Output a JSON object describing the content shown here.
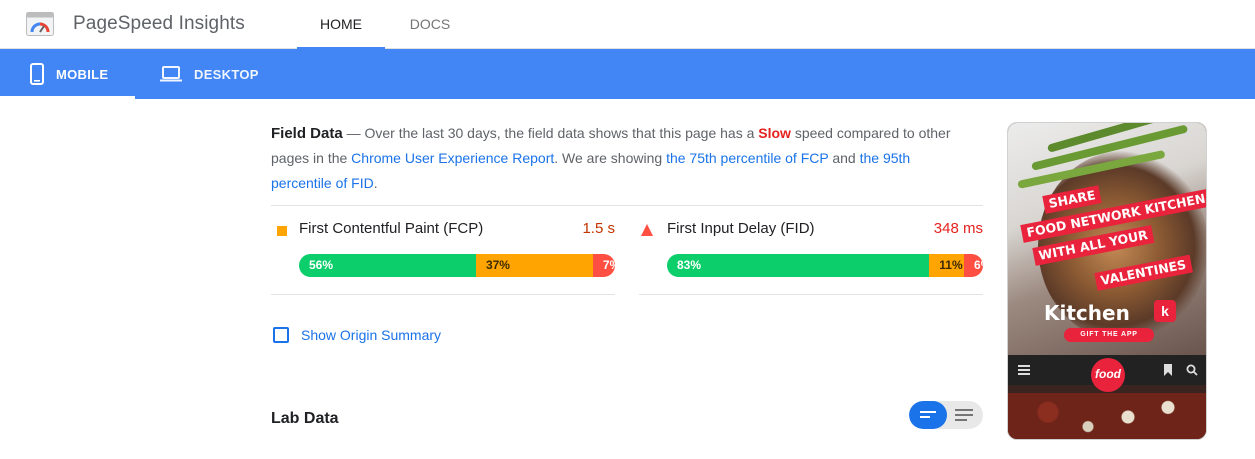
{
  "header": {
    "app_title": "PageSpeed Insights",
    "tabs": [
      {
        "label": "HOME",
        "active": true
      },
      {
        "label": "DOCS",
        "active": false
      }
    ]
  },
  "device_tabs": [
    {
      "label": "MOBILE",
      "icon": "smartphone-icon",
      "active": true
    },
    {
      "label": "DESKTOP",
      "icon": "laptop-icon",
      "active": false
    }
  ],
  "field_data": {
    "heading": "Field Data",
    "desc_prefix": " — Over the last 30 days, the field data shows that this page has a ",
    "speed": "Slow",
    "desc_mid": " speed compared to other pages in the ",
    "report_link": "Chrome User Experience Report",
    "desc_showing": ". We are showing ",
    "fcp_link": "the 75th percentile of FCP",
    "desc_and": " and ",
    "fid_link": "the 95th percentile of FID",
    "desc_end": ".",
    "metrics": [
      {
        "label": "First Contentful Paint (FCP)",
        "value": "1.5 s",
        "indicator": "average-square-icon",
        "distribution": [
          {
            "label": "56%",
            "pct": 56,
            "color": "#0cce6b"
          },
          {
            "label": "37%",
            "pct": 37,
            "color": "#ffa400"
          },
          {
            "label": "7%",
            "pct": 7,
            "color": "#ff4e42"
          }
        ]
      },
      {
        "label": "First Input Delay (FID)",
        "value": "348 ms",
        "indicator": "slow-triangle-icon",
        "distribution": [
          {
            "label": "83%",
            "pct": 83,
            "color": "#0cce6b"
          },
          {
            "label": "11%",
            "pct": 11,
            "color": "#ffa400"
          },
          {
            "label": "6%",
            "pct": 6,
            "color": "#ff4e42"
          }
        ]
      }
    ],
    "origin_summary_label": "Show Origin Summary"
  },
  "lab_data": {
    "heading": "Lab Data",
    "view_toggle": {
      "selected": "compact",
      "options": [
        "compact-view-icon",
        "list-view-icon"
      ]
    }
  },
  "screenshot_preview": {
    "banner_lines": [
      "SHARE",
      "FOOD NETWORK KITCHEN",
      "WITH ALL YOUR",
      "VALENTINES"
    ],
    "brand": "Kitchen",
    "brand_badge": "food",
    "ok_badge": "k",
    "cta": "GIFT THE APP",
    "nav_logo": "food"
  },
  "colors": {
    "accent": "#4285f4",
    "link": "#1a73e8",
    "slow": "#e5221e",
    "average_value": "#c33300",
    "good": "#0cce6b",
    "average": "#ffa400",
    "poor": "#ff4e42"
  }
}
